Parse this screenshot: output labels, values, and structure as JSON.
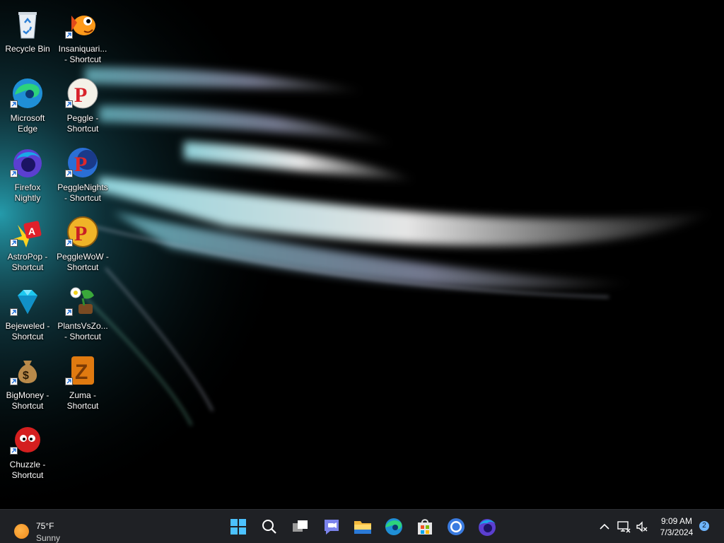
{
  "desktop": {
    "icons": [
      {
        "name": "Recycle Bin",
        "label": "Recycle Bin",
        "shortcut": false,
        "icon": "recycle-bin-icon"
      },
      {
        "name": "Insaniquarium Shortcut",
        "label": "Insaniquari...\n- Shortcut",
        "shortcut": true,
        "icon": "goldfish-icon"
      },
      {
        "name": "Microsoft Edge",
        "label": "Microsoft\nEdge",
        "shortcut": true,
        "icon": "edge-icon"
      },
      {
        "name": "Peggle Shortcut",
        "label": "Peggle -\nShortcut",
        "shortcut": true,
        "icon": "peggle-icon"
      },
      {
        "name": "Firefox Nightly",
        "label": "Firefox\nNightly",
        "shortcut": true,
        "icon": "firefox-nightly-icon"
      },
      {
        "name": "PeggleNights Shortcut",
        "label": "PeggleNights\n- Shortcut",
        "shortcut": true,
        "icon": "peggle-nights-icon"
      },
      {
        "name": "AstroPop Shortcut",
        "label": "AstroPop -\nShortcut",
        "shortcut": true,
        "icon": "astropop-icon"
      },
      {
        "name": "PeggleWoW Shortcut",
        "label": "PeggleWoW -\nShortcut",
        "shortcut": true,
        "icon": "peggle-wow-icon"
      },
      {
        "name": "Bejeweled Shortcut",
        "label": "Bejeweled -\nShortcut",
        "shortcut": true,
        "icon": "gem-icon"
      },
      {
        "name": "PlantsVsZombies Shortcut",
        "label": "PlantsVsZo...\n- Shortcut",
        "shortcut": true,
        "icon": "plants-vs-zombies-icon"
      },
      {
        "name": "BigMoney Shortcut",
        "label": "BigMoney -\nShortcut",
        "shortcut": true,
        "icon": "money-bag-icon"
      },
      {
        "name": "Zuma Shortcut",
        "label": "Zuma -\nShortcut",
        "shortcut": true,
        "icon": "zuma-icon"
      },
      {
        "name": "Chuzzle Shortcut",
        "label": "Chuzzle -\nShortcut",
        "shortcut": true,
        "icon": "chuzzle-icon"
      }
    ]
  },
  "taskbar": {
    "weather": {
      "temp": "75°F",
      "condition": "Sunny",
      "icon": "sun-icon"
    },
    "apps": [
      {
        "name": "Start",
        "icon": "windows-start-icon"
      },
      {
        "name": "Search",
        "icon": "search-icon"
      },
      {
        "name": "Task View",
        "icon": "task-view-icon"
      },
      {
        "name": "Chat",
        "icon": "teams-chat-icon"
      },
      {
        "name": "File Explorer",
        "icon": "file-explorer-icon"
      },
      {
        "name": "Microsoft Edge",
        "icon": "edge-icon"
      },
      {
        "name": "Microsoft Store",
        "icon": "store-icon"
      },
      {
        "name": "Chrome",
        "icon": "chrome-icon"
      },
      {
        "name": "Firefox Nightly",
        "icon": "firefox-nightly-icon"
      }
    ],
    "tray": {
      "overflow_icon": "chevron-up-icon",
      "network_icon": "network-disconnected-icon",
      "volume_icon": "volume-muted-icon",
      "time": "9:09 AM",
      "date": "7/3/2024",
      "notification_count": "2"
    }
  },
  "colors": {
    "taskbar_bg": "#1f2125",
    "desktop_bg": "#000000",
    "accent": "#4cc2ff"
  }
}
